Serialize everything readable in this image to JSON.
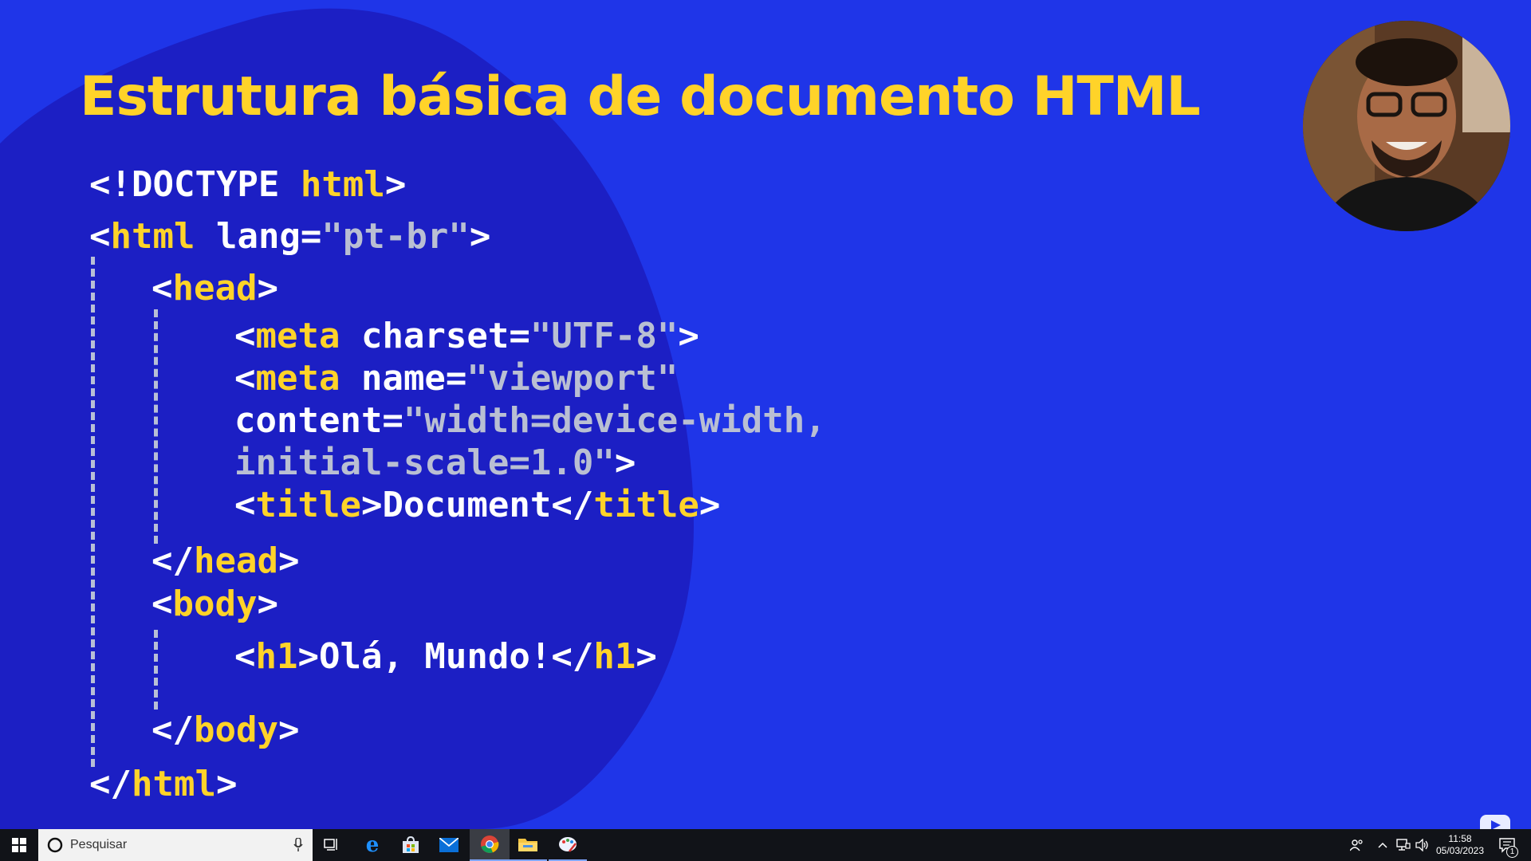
{
  "slide": {
    "title": "Estrutura básica de documento HTML",
    "colors": {
      "background": "#1f35e8",
      "blob": "#1c1fc4",
      "title": "#ffd329",
      "tag": "#ffd329",
      "text": "#ffffff",
      "value": "#b9bfd3"
    }
  },
  "code": {
    "l1": {
      "a": "<!",
      "b": "DOCTYPE",
      "c": " ",
      "d": "html",
      "e": ">"
    },
    "l2": {
      "a": "<",
      "b": "html",
      "c": " lang=",
      "d": "\"pt-br\"",
      "e": ">"
    },
    "l3": {
      "a": "<",
      "b": "head",
      "c": ">"
    },
    "l4": {
      "a": "<",
      "b": "meta",
      "c": " charset=",
      "d": "\"UTF-8\"",
      "e": ">"
    },
    "l5": {
      "a": "<",
      "b": "meta",
      "c": " name=",
      "d": "\"viewport\""
    },
    "l6": {
      "a": "content=",
      "b": "\"width=device-width,"
    },
    "l7": {
      "a": "initial-scale=1.0\"",
      "b": ">"
    },
    "l8": {
      "a": "<",
      "b": "title",
      "c": ">",
      "d": "Document",
      "e": "</",
      "f": "title",
      "g": ">"
    },
    "l9": {
      "a": "</",
      "b": "head",
      "c": ">"
    },
    "l10": {
      "a": "<",
      "b": "body",
      "c": ">"
    },
    "l11": {
      "a": "<",
      "b": "h1",
      "c": ">",
      "d": "Olá, Mundo!",
      "e": "</",
      "f": "h1",
      "g": ">"
    },
    "l12": {
      "a": "</",
      "b": "body",
      "c": ">"
    },
    "l13": {
      "a": "</",
      "b": "html",
      "c": ">"
    }
  },
  "taskbar": {
    "search_placeholder": "Pesquisar",
    "clock_time": "11:58",
    "clock_date": "05/03/2023",
    "notification_count": "1",
    "icons": [
      "windows-start-icon",
      "cortana-circle-icon",
      "microphone-icon",
      "task-view-icon",
      "edge-icon",
      "store-icon",
      "mail-icon",
      "chrome-icon",
      "file-explorer-icon",
      "paint-icon",
      "people-icon",
      "chevron-up-icon",
      "network-icon",
      "volume-icon",
      "action-center-icon"
    ]
  }
}
